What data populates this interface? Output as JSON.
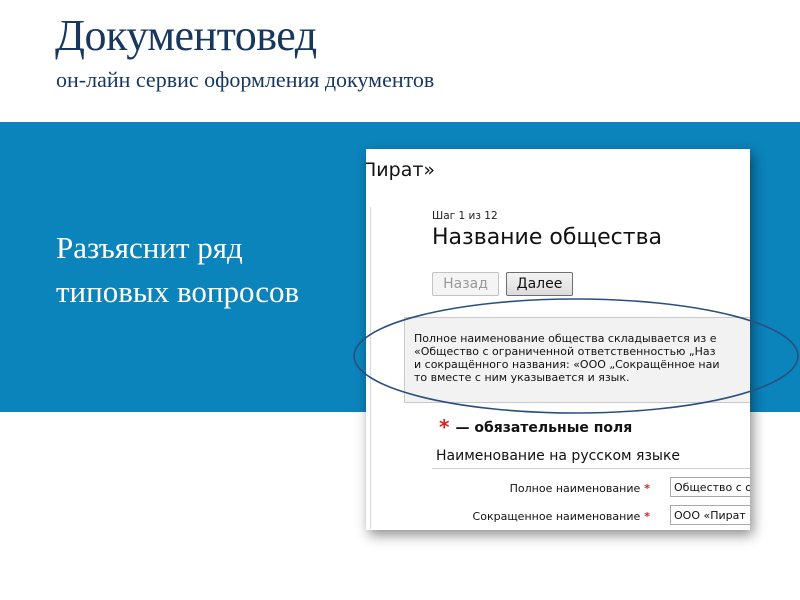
{
  "slide": {
    "title": "Документовед",
    "subtitle": "он-лайн сервис оформления документов",
    "band_text_line1": "Разъяснит ряд",
    "band_text_line2": "типовых вопросов",
    "band_color": "#0b84bc",
    "title_color": "#17375e"
  },
  "screenshot": {
    "heading": "Пират»",
    "step": "Шаг 1 из 12",
    "form_title": "Название общества",
    "back_button": "Назад",
    "next_button": "Далее",
    "info_lines": [
      "Полное наименование общества складывается из е",
      "«Общество с ограниченной ответственностью „Наз",
      "и сокращённого названия: «ООО „Сокращённое наи",
      "то вместе с ним указывается и язык."
    ],
    "required_star": "*",
    "required_note": "— обязательные поля",
    "section_title": "Наименование на русском языке",
    "fields": {
      "full_label": "Полное наименование",
      "full_value": "Общество с о",
      "short_label": "Сокращенное наименование",
      "short_value": "ООО «Пират"
    }
  }
}
